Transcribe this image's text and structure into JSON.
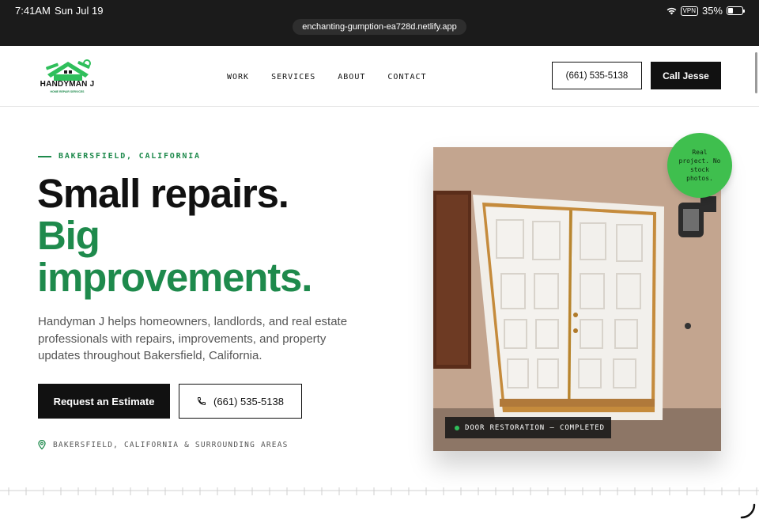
{
  "status_bar": {
    "time": "7:41AM",
    "date": "Sun Jul 19",
    "vpn": "VPN",
    "battery": "35%",
    "url": "enchanting-gumption-ea728d.netlify.app"
  },
  "header": {
    "logo_text": "HANDYMAN J",
    "logo_subtext": "HOME REPAIR SERVICES",
    "nav": [
      "WORK",
      "SERVICES",
      "ABOUT",
      "CONTACT"
    ],
    "phone_button": "(661) 535-5138",
    "call_button": "Call Jesse"
  },
  "hero": {
    "eyebrow": "BAKERSFIELD, CALIFORNIA",
    "headline_line1": "Small repairs.",
    "headline_line2": "Big",
    "headline_line3": "improvements.",
    "lede": "Handyman J helps homeowners, landlords, and real estate professionals with repairs, improvements, and property updates throughout Bakersfield, California.",
    "primary_button": "Request an Estimate",
    "phone_button": "(661) 535-5138",
    "location": "BAKERSFIELD, CALIFORNIA & SURROUNDING AREAS"
  },
  "photo": {
    "badge": "Real project. No stock photos.",
    "caption": "DOOR RESTORATION — COMPLETED"
  },
  "colors": {
    "brand_green": "#1e8a4c",
    "badge_green": "#3fbf4e",
    "dark": "#111111"
  }
}
